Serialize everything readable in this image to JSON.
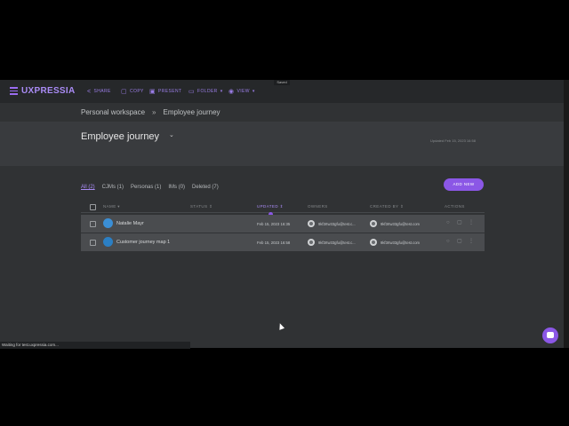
{
  "toolbar": {
    "logo": "UXPRESSIA",
    "items": [
      {
        "label": "SHARE",
        "icon": "share-icon"
      },
      {
        "label": "COPY",
        "icon": "copy-icon"
      },
      {
        "label": "PRESENT",
        "icon": "present-icon"
      },
      {
        "label": "FOLDER",
        "icon": "folder-icon"
      },
      {
        "label": "VIEW",
        "icon": "eye-icon"
      }
    ],
    "saved": "Saved"
  },
  "breadcrumb": {
    "workspace": "Personal workspace",
    "separator": "»",
    "current": "Employee journey"
  },
  "header": {
    "title": "Employee journey",
    "updated": "Updated Feb 15, 2023 16:58"
  },
  "filters": [
    {
      "label": "All (2)",
      "active": true
    },
    {
      "label": "CJMs (1)"
    },
    {
      "label": "Personas (1)"
    },
    {
      "label": "IMs (0)"
    },
    {
      "label": "Deleted (7)"
    }
  ],
  "add_new": "ADD NEW",
  "table": {
    "columns": {
      "name": "NAME",
      "status": "STATUS",
      "updated": "UPDATED",
      "owners": "OWNERS",
      "created_by": "CREATED BY",
      "actions": "ACTIONS"
    },
    "rows": [
      {
        "name": "Natalie Mayr",
        "updated": "Feb 15, 2023 16:35",
        "owner": "9kf3rtw33gfu@test.c...",
        "created_by": "9kf3rtw33gfu@test.com"
      },
      {
        "name": "Customer journey map 1",
        "updated": "Feb 15, 2023 16:58",
        "owner": "9kf3rtw33gfu@test.c...",
        "created_by": "9kf3rtw33gfu@test.com"
      }
    ]
  },
  "status_bar": "Waiting for test.uxpressia.com...",
  "colors": {
    "accent": "#8b57e6",
    "background": "#303234",
    "row": "#4a4c4f"
  }
}
